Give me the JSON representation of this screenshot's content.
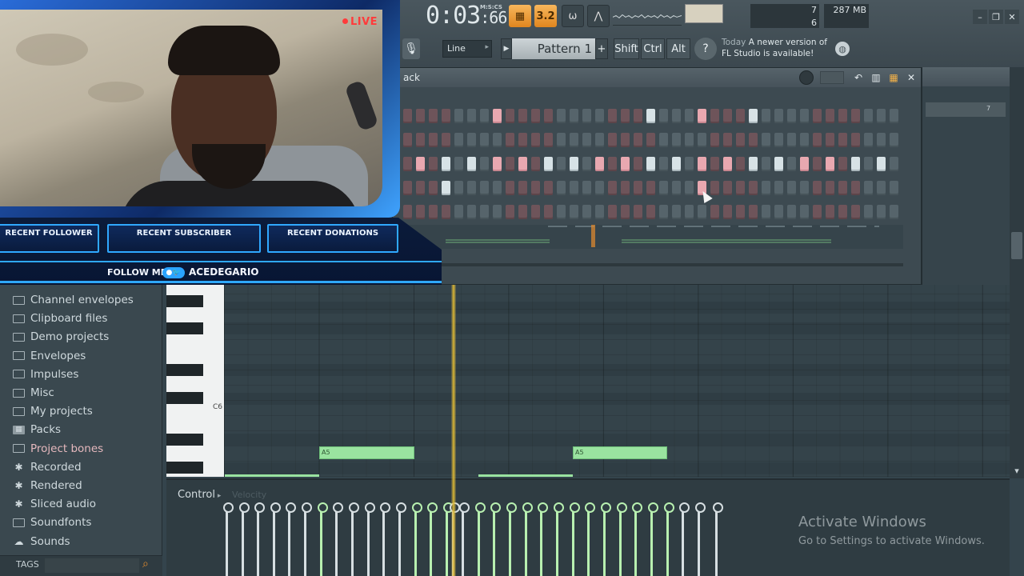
{
  "toolbar": {
    "time_main": "0:03",
    "time_sub": "66",
    "time_format": "M:S:CS",
    "tempo_badge": "3.2",
    "cpu_value": "7",
    "poly_value": "6",
    "memory": "287 MB",
    "line_mode": "Line",
    "pattern_name": "Pattern 1",
    "shift_label": "Shift",
    "ctrl_label": "Ctrl",
    "alt_label": "Alt",
    "news_when": "Today",
    "news_text_1": "A newer version of",
    "news_text_2": "FL Studio is available!"
  },
  "channel_rack": {
    "title": "ack"
  },
  "playlist_panel": {
    "bar_label": "7"
  },
  "browser": {
    "items": [
      {
        "label": "Channel envelopes",
        "icon": "folder-icon"
      },
      {
        "label": "Clipboard files",
        "icon": "folder-icon"
      },
      {
        "label": "Demo projects",
        "icon": "folder-icon"
      },
      {
        "label": "Envelopes",
        "icon": "folder-icon"
      },
      {
        "label": "Impulses",
        "icon": "folder-icon"
      },
      {
        "label": "Misc",
        "icon": "folder-icon"
      },
      {
        "label": "My projects",
        "icon": "folder-icon"
      },
      {
        "label": "Packs",
        "icon": "packs-icon"
      },
      {
        "label": "Project bones",
        "icon": "folder-icon"
      },
      {
        "label": "Recorded",
        "icon": "recorded-icon"
      },
      {
        "label": "Rendered",
        "icon": "rendered-icon"
      },
      {
        "label": "Sliced audio",
        "icon": "sliced-icon"
      },
      {
        "label": "Soundfonts",
        "icon": "folder-icon"
      },
      {
        "label": "Sounds",
        "icon": "cloud-icon"
      }
    ],
    "tags_label": "TAGS"
  },
  "piano_roll": {
    "key_label": "C6",
    "notes": [
      {
        "label": "A5"
      },
      {
        "label": "A5"
      }
    ]
  },
  "control": {
    "label": "Control",
    "sub_label": "Velocity"
  },
  "windows_notice": {
    "title": "Activate Windows",
    "subtitle": "Go to Settings to activate Windows."
  },
  "stream_overlay": {
    "live_label": "LIVE",
    "recent_follower": "RECENT FOLLOWER",
    "recent_subscriber": "RECENT SUBSCRIBER",
    "recent_donations": "RECENT DONATIONS",
    "follow_me": "FOLLOW ME",
    "handle": "ACEDEGARIO"
  },
  "colors": {
    "accent_orange": "#e0861f",
    "note_green": "#9ae3a0",
    "step_on_pink": "#e8a8b0",
    "overlay_blue": "#2fa8ff",
    "live_red": "#ff3b3b"
  }
}
